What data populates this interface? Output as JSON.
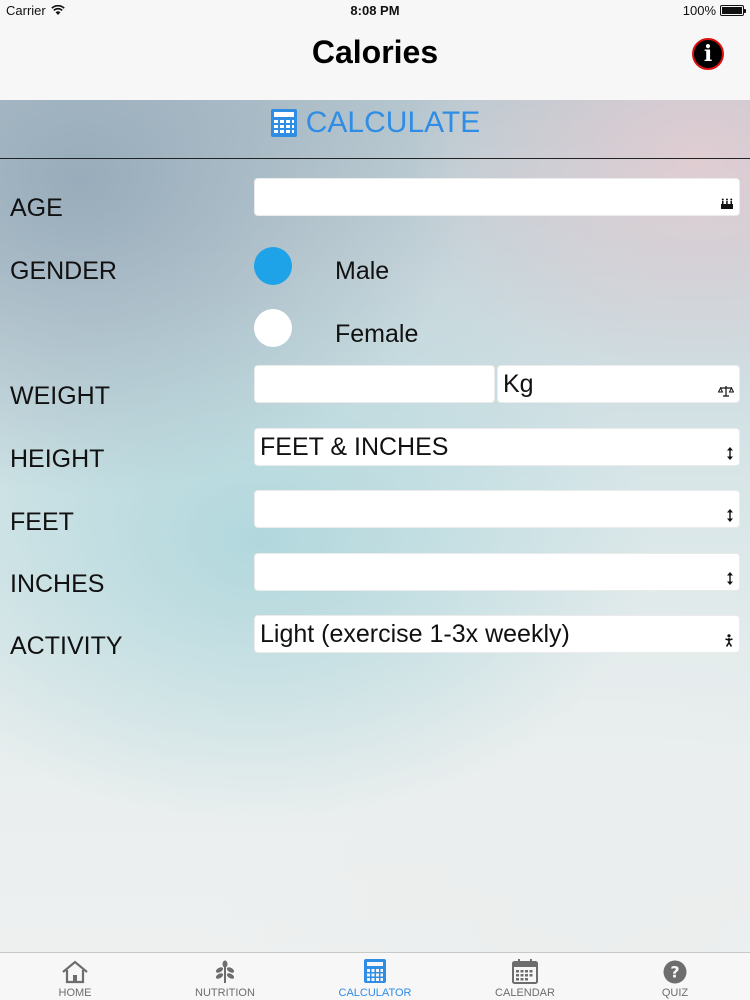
{
  "status_bar": {
    "carrier": "Carrier",
    "time": "8:08 PM",
    "battery": "100%"
  },
  "nav": {
    "title": "Calories",
    "info_icon_glyph": "i"
  },
  "calculate": {
    "label": "CALCULATE",
    "color": "#2f8de4"
  },
  "form": {
    "age": {
      "label": "AGE",
      "value": ""
    },
    "gender": {
      "label": "GENDER",
      "options": [
        {
          "label": "Male",
          "selected": true
        },
        {
          "label": "Female",
          "selected": false
        }
      ]
    },
    "weight": {
      "label": "WEIGHT",
      "value": "",
      "unit": "Kg"
    },
    "height": {
      "label": "HEIGHT",
      "value": "FEET & INCHES"
    },
    "feet": {
      "label": "FEET",
      "value": ""
    },
    "inches": {
      "label": "INCHES",
      "value": ""
    },
    "activity": {
      "label": "ACTIVITY",
      "value": "Light (exercise 1-3x weekly)"
    }
  },
  "tabs": [
    {
      "label": "HOME",
      "icon": "home-icon",
      "active": false
    },
    {
      "label": "NUTRITION",
      "icon": "plant-icon",
      "active": false
    },
    {
      "label": "CALCULATOR",
      "icon": "calculator-icon",
      "active": true
    },
    {
      "label": "CALENDAR",
      "icon": "calendar-icon",
      "active": false
    },
    {
      "label": "QUIZ",
      "icon": "question-icon",
      "active": false
    }
  ],
  "colors": {
    "accent": "#2f8de4",
    "radio_selected": "#1fa3e8"
  }
}
